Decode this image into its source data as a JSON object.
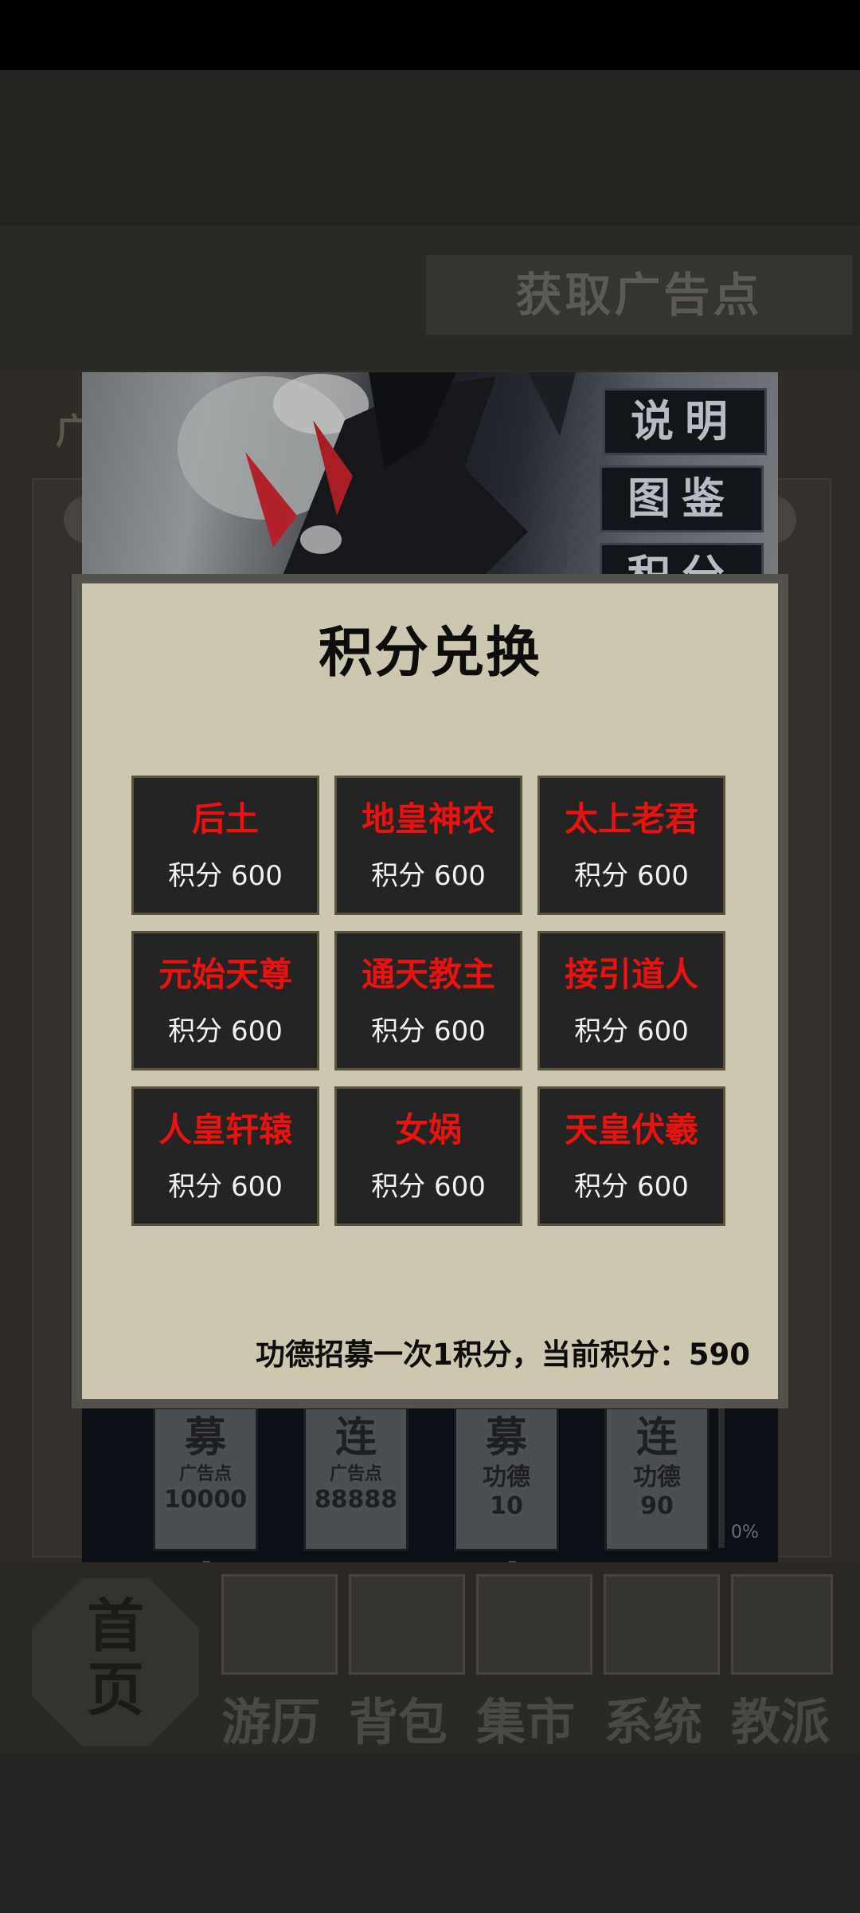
{
  "background": {
    "ad_button": "获取广告点",
    "side_text": "广",
    "side_buttons": [
      "说明",
      "图鉴",
      "积分"
    ],
    "recruit_cards": [
      {
        "big": "募",
        "cost_label": "广告点",
        "cost": "10000"
      },
      {
        "big": "连",
        "cost_label": "广告点",
        "cost": "88888"
      },
      {
        "big": "募",
        "cost_label": "功德",
        "cost": "10"
      },
      {
        "big": "连",
        "cost_label": "功德",
        "cost": "90"
      }
    ],
    "plus": "+",
    "progress": "0%",
    "nav": {
      "home": "首页",
      "items": [
        "游历",
        "背包",
        "集市",
        "系统",
        "教派"
      ]
    }
  },
  "modal": {
    "title": "积分兑换",
    "items": [
      {
        "name": "后土",
        "cost": "积分 600"
      },
      {
        "name": "地皇神农",
        "cost": "积分 600"
      },
      {
        "name": "太上老君",
        "cost": "积分 600"
      },
      {
        "name": "元始天尊",
        "cost": "积分 600"
      },
      {
        "name": "通天教主",
        "cost": "积分 600"
      },
      {
        "name": "接引道人",
        "cost": "积分 600"
      },
      {
        "name": "人皇轩辕",
        "cost": "积分 600"
      },
      {
        "name": "女娲",
        "cost": "积分 600"
      },
      {
        "name": "天皇伏羲",
        "cost": "积分 600"
      }
    ],
    "footer": "功德招募一次1积分，当前积分：590"
  },
  "colors": {
    "modal_bg": "#cdc7b1",
    "card_bg": "#242424",
    "item_name": "#e8120f",
    "item_cost": "#f2f2f2"
  }
}
